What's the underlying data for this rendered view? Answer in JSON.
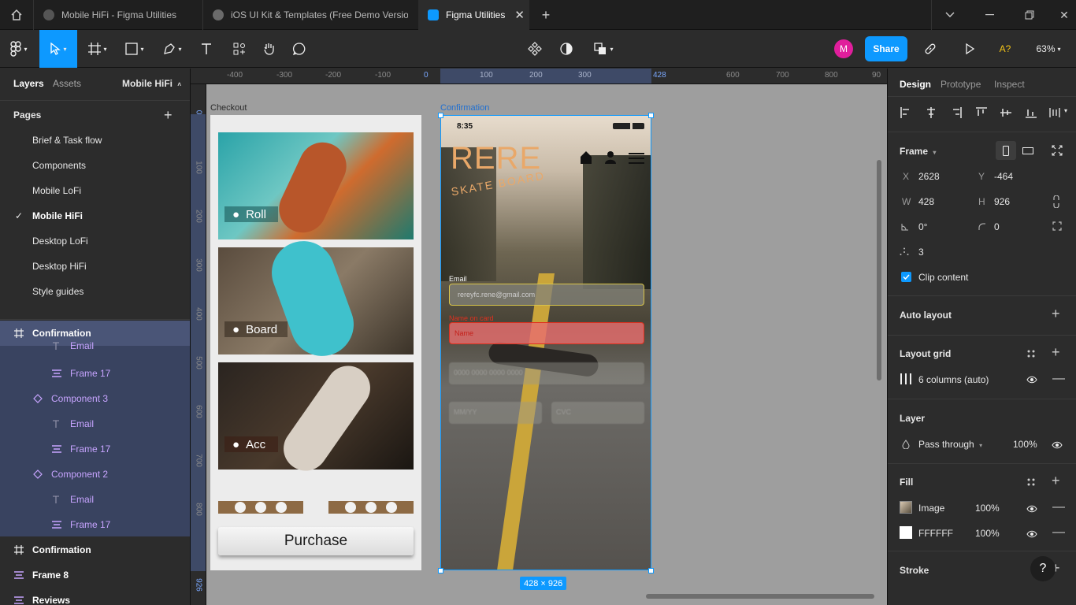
{
  "browser": {
    "tabs": [
      {
        "label": "Mobile HiFi - Figma Utilities",
        "active": false
      },
      {
        "label": "iOS UI Kit & Templates (Free Demo Version)",
        "active": false
      },
      {
        "label": "Figma Utilities",
        "active": true
      }
    ],
    "new_tab": "+"
  },
  "toolbar": {
    "avatar_initial": "M",
    "share_label": "Share",
    "font_missing": "A?",
    "zoom": "63%",
    "colors": {
      "accent": "#0d99ff",
      "avatar": "#e01e9c",
      "font_warning": "#f5c518"
    }
  },
  "left_panel": {
    "tabs": {
      "layers": "Layers",
      "assets": "Assets",
      "file": "Mobile HiFi"
    },
    "pages_title": "Pages",
    "pages": [
      "Brief & Task flow",
      "Components",
      "Mobile LoFi",
      "Mobile HiFi",
      "Desktop LoFi",
      "Desktop HiFi",
      "Style guides"
    ],
    "current_page": "Mobile HiFi",
    "layers": [
      {
        "label": "Confirmation",
        "icon": "frame-icon",
        "depth": 0
      },
      {
        "label": "Email",
        "icon": "text-icon",
        "depth": 2
      },
      {
        "label": "Frame 17",
        "icon": "autolayout-icon",
        "depth": 2
      },
      {
        "label": "Component 3",
        "icon": "instance-icon",
        "depth": 1
      },
      {
        "label": "Email",
        "icon": "text-icon",
        "depth": 2
      },
      {
        "label": "Frame 17",
        "icon": "autolayout-icon",
        "depth": 2
      },
      {
        "label": "Component 2",
        "icon": "instance-icon",
        "depth": 1
      },
      {
        "label": "Email",
        "icon": "text-icon",
        "depth": 2
      },
      {
        "label": "Frame 17",
        "icon": "autolayout-icon",
        "depth": 2
      },
      {
        "label": "Confirmation",
        "icon": "frame-icon",
        "depth": 0
      },
      {
        "label": "Frame 8",
        "icon": "autolayout-icon",
        "depth": 0
      },
      {
        "label": "Reviews",
        "icon": "autolayout-icon",
        "depth": 0
      }
    ]
  },
  "rulers": {
    "top": [
      "-400",
      "-300",
      "-200",
      "-100",
      "0",
      "100",
      "200",
      "300",
      "428",
      "600",
      "700",
      "800",
      "90"
    ],
    "left": [
      "0",
      "100",
      "200",
      "300",
      "400",
      "500",
      "600",
      "700",
      "800",
      "926"
    ]
  },
  "canvas": {
    "checkout": {
      "frame_label": "Checkout",
      "cards": [
        "Roll",
        "Board",
        "Acc"
      ],
      "purchase": "Purchase"
    },
    "confirmation": {
      "frame_label": "Confirmation",
      "time": "8:35",
      "brand": "RERE",
      "brand_sub": "SKATE BOARD",
      "email_label": "Email",
      "email_placeholder": "rereyfc.rene@gmail.com",
      "name_label": "Name on card",
      "name_placeholder": "Name",
      "card_placeholder": "0000 0000 0000 0000",
      "expiry_placeholder": "MM/YY",
      "cvc_placeholder": "CVC",
      "size_badge": "428 × 926"
    }
  },
  "right_panel": {
    "tabs": [
      "Design",
      "Prototype",
      "Inspect"
    ],
    "frame_title": "Frame",
    "x_label": "X",
    "x_value": "2628",
    "y_label": "Y",
    "y_value": "-464",
    "w_label": "W",
    "w_value": "428",
    "h_label": "H",
    "h_value": "926",
    "rotation": "0°",
    "radius": "0",
    "points": "3",
    "clip_content": "Clip content",
    "auto_layout": "Auto layout",
    "layout_grid": "Layout grid",
    "grid_value": "6 columns (auto)",
    "layer": "Layer",
    "blend": "Pass through",
    "layer_opacity": "100%",
    "fill": "Fill",
    "fills": [
      {
        "name": "Image",
        "opacity": "100%"
      },
      {
        "name": "FFFFFF",
        "opacity": "100%"
      }
    ],
    "stroke": "Stroke",
    "help": "?"
  }
}
